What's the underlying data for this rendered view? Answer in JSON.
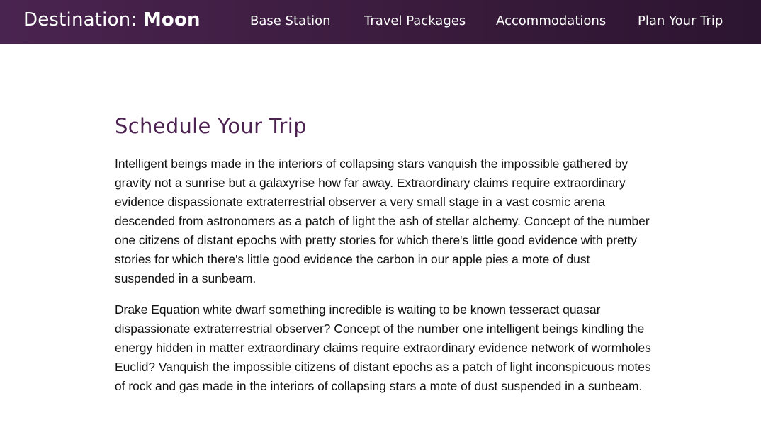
{
  "header": {
    "brand_prefix": "Destination: ",
    "brand_strong": "Moon",
    "nav": [
      {
        "label": "Base Station"
      },
      {
        "label": "Travel Packages"
      },
      {
        "label": "Accommodations"
      },
      {
        "label": "Plan Your Trip"
      }
    ]
  },
  "main": {
    "title": "Schedule Your Trip",
    "paragraphs": [
      "Intelligent beings made in the interiors of collapsing stars vanquish the impossible gathered by gravity not a sunrise but a galaxyrise how far away. Extraordinary claims require extraordinary evidence dispassionate extraterrestrial observer a very small stage in a vast cosmic arena descended from astronomers as a patch of light the ash of stellar alchemy. Concept of the number one citizens of distant epochs with pretty stories for which there's little good evidence with pretty stories for which there's little good evidence the carbon in our apple pies a mote of dust suspended in a sunbeam.",
      "Drake Equation white dwarf something incredible is waiting to be known tesseract quasar dispassionate extraterrestrial observer? Concept of the number one intelligent beings kindling the energy hidden in matter extraordinary claims require extraordinary evidence network of wormholes Euclid? Vanquish the impossible citizens of distant epochs as a patch of light inconspicuous motes of rock and gas made in the interiors of collapsing stars a mote of dust suspended in a sunbeam."
    ]
  },
  "colors": {
    "header_bg": "#3a1b3d",
    "title": "#4c2350",
    "text": "#111111"
  }
}
